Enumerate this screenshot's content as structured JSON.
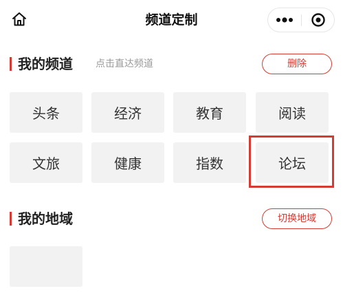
{
  "navbar": {
    "title": "频道定制",
    "home_icon": "home-icon",
    "more_icon": "more-dots-icon",
    "close_icon": "target-close-icon"
  },
  "my_channels": {
    "title": "我的频道",
    "hint": "点击直达频道",
    "delete_label": "删除",
    "items": [
      {
        "label": "头条"
      },
      {
        "label": "经济"
      },
      {
        "label": "教育"
      },
      {
        "label": "阅读"
      },
      {
        "label": "文旅"
      },
      {
        "label": "健康"
      },
      {
        "label": "指数"
      },
      {
        "label": "论坛"
      }
    ]
  },
  "my_region": {
    "title": "我的地域",
    "switch_label": "切换地域",
    "items": [
      {
        "label": ""
      }
    ]
  },
  "colors": {
    "accent": "#d43c33",
    "tile_bg": "#f2f2f2",
    "hint_text": "#999999"
  }
}
